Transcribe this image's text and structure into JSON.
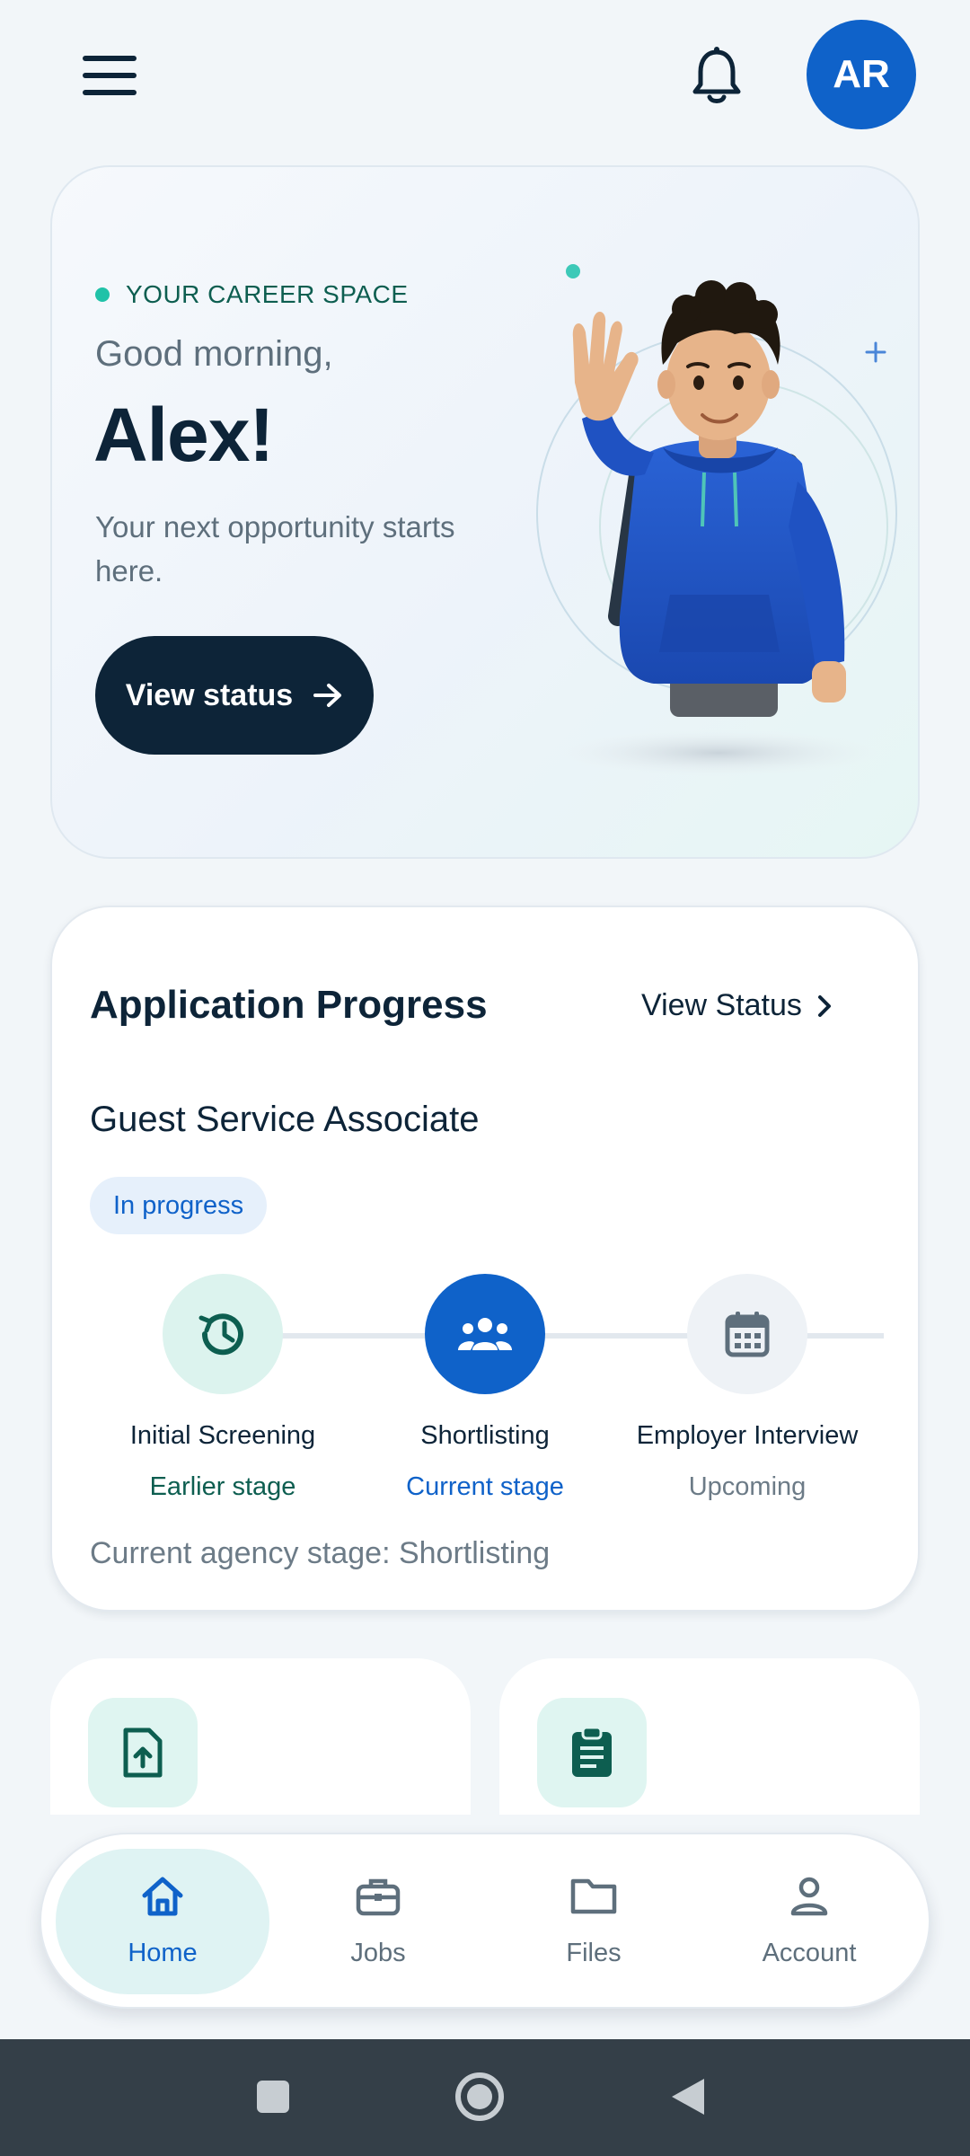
{
  "header": {
    "avatar_initials": "AR",
    "menu_icon": "hamburger-menu-icon",
    "bell_icon": "bell-icon"
  },
  "hero": {
    "eyebrow": "YOUR CAREER SPACE",
    "greeting": "Good morning,",
    "name": "Alex!",
    "tagline": "Your next opportunity starts here.",
    "button_label": "View status"
  },
  "progress": {
    "title": "Application Progress",
    "link_label": "View Status",
    "job_title": "Guest Service Associate",
    "status_badge": "In progress",
    "stages": [
      {
        "name": "Initial Screening",
        "status": "Earlier stage",
        "icon": "history-icon"
      },
      {
        "name": "Shortlisting",
        "status": "Current stage",
        "icon": "group-icon"
      },
      {
        "name": "Employer Interview",
        "status": "Upcoming",
        "icon": "calendar-icon"
      }
    ],
    "agency_stage": "Current agency stage: Shortlisting"
  },
  "quick_cards": [
    {
      "icon": "file-upload-icon"
    },
    {
      "icon": "clipboard-icon"
    }
  ],
  "nav": {
    "items": [
      {
        "label": "Home",
        "icon": "home-icon",
        "active": true
      },
      {
        "label": "Jobs",
        "icon": "briefcase-icon",
        "active": false
      },
      {
        "label": "Files",
        "icon": "folder-icon",
        "active": false
      },
      {
        "label": "Account",
        "icon": "person-icon",
        "active": false
      }
    ]
  },
  "colors": {
    "accent_blue": "#0f62c9",
    "navy": "#0d2438",
    "teal": "#20c2a8",
    "teal_dark": "#0d5e50"
  }
}
